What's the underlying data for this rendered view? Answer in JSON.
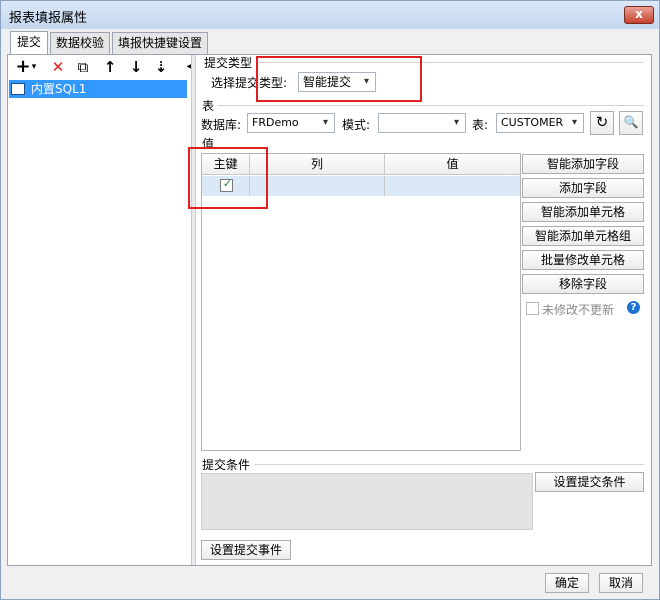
{
  "window": {
    "title": "报表填报属性",
    "close_label": "x"
  },
  "tabs": [
    {
      "label": "提交",
      "active": true
    },
    {
      "label": "数据校验",
      "active": false
    },
    {
      "label": "填报快捷键设置",
      "active": false
    }
  ],
  "toolbar": {
    "add": "+",
    "add_dropdown": "▾",
    "delete": "✕",
    "copy": "⧉",
    "up": "↑",
    "down": "↓",
    "sort": "⇣",
    "collapse": "◂"
  },
  "tree": {
    "items": [
      {
        "label": "内置SQL1",
        "selected": true
      }
    ]
  },
  "submit_type": {
    "group_label": "提交类型",
    "label": "选择提交类型:",
    "value": "智能提交"
  },
  "table_section": {
    "group_label": "表",
    "database_label": "数据库:",
    "database_value": "FRDemo",
    "schema_label": "模式:",
    "schema_value": "",
    "table_label": "表:",
    "table_value": "CUSTOMER"
  },
  "values_section": {
    "group_label": "值",
    "columns": [
      "主键",
      "列",
      "值"
    ],
    "rows": [
      {
        "primary_key": true,
        "column": "",
        "value": ""
      }
    ]
  },
  "side_buttons": {
    "smart_add_field": "智能添加字段",
    "add_field": "添加字段",
    "smart_add_cell": "智能添加单元格",
    "smart_add_cell_group": "智能添加单元格组",
    "batch_modify_cell": "批量修改单元格",
    "remove_field": "移除字段",
    "no_update_unmodified": "未修改不更新",
    "help": "?"
  },
  "submit_condition": {
    "group_label": "提交条件",
    "button": "设置提交条件"
  },
  "submit_event_button": "设置提交事件",
  "footer": {
    "ok": "确定",
    "cancel": "取消"
  },
  "colors": {
    "selection": "#3399ff",
    "row_highlight": "#dbe8f6",
    "annotation_red": "#e02020",
    "help_blue": "#1e73d2"
  }
}
